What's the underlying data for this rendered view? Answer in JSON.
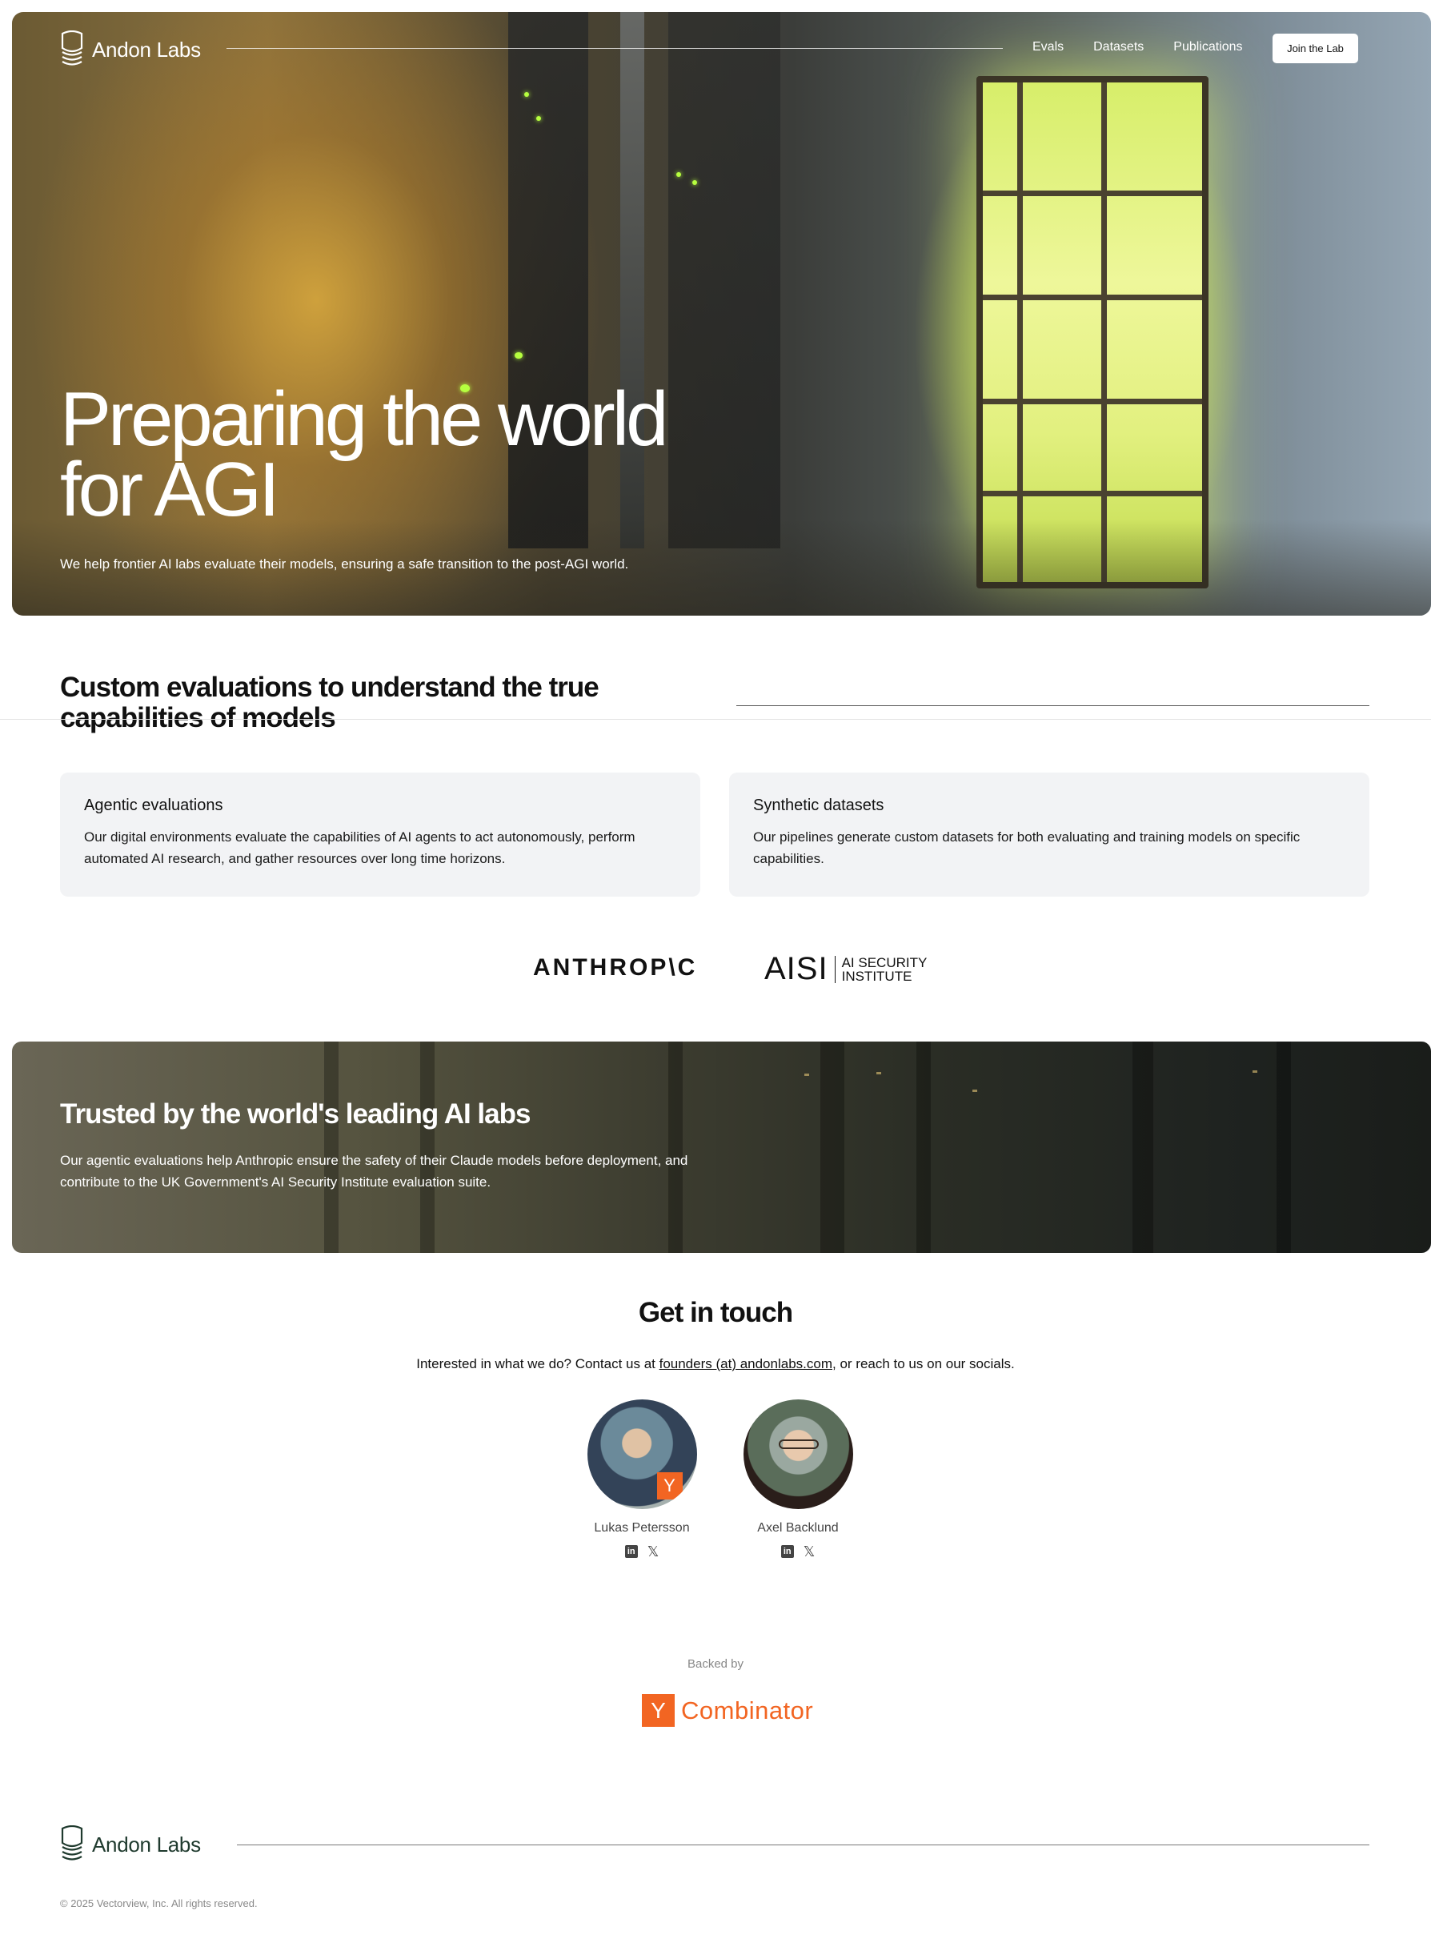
{
  "brand": {
    "name": "Andon Labs"
  },
  "nav": {
    "links": [
      "Evals",
      "Datasets",
      "Publications"
    ],
    "cta": "Join the Lab"
  },
  "hero": {
    "title": "Preparing the world for AGI",
    "subtitle": "We help frontier AI labs evaluate their models, ensuring a safe transition to the post-AGI world."
  },
  "capabilities": {
    "title": "Custom evaluations to understand the true capabilities of models",
    "cards": [
      {
        "title": "Agentic evaluations",
        "desc": "Our digital environments evaluate the capabilities of AI agents to act autonomously, perform automated AI research, and gather resources over long time horizons."
      },
      {
        "title": "Synthetic datasets",
        "desc": "Our pipelines generate custom datasets for both evaluating and training models on specific capabilities."
      }
    ]
  },
  "partners": {
    "anthropic": "ANTHROP\\C",
    "aisi_short": "AISI",
    "aisi_line1": "AI SECURITY",
    "aisi_line2": "INSTITUTE"
  },
  "trusted": {
    "title": "Trusted by the world's leading AI labs",
    "text": "Our agentic evaluations help Anthropic ensure the safety of their Claude models before deployment, and contribute to the UK Government's AI Security Institute evaluation suite."
  },
  "contact": {
    "title": "Get in touch",
    "text_before": "Interested in what we do? Contact us at ",
    "email": "founders (at) andonlabs.com",
    "text_after": ", or reach to us on our socials.",
    "people": [
      {
        "name": "Lukas Petersson",
        "yc_badge": "Y"
      },
      {
        "name": "Axel Backlund"
      }
    ],
    "social_icons": [
      "linkedin-icon",
      "x-icon"
    ]
  },
  "backed": {
    "label": "Backed by",
    "yc_letter": "Y",
    "yc_word": "Combinator"
  },
  "footer": {
    "copyright": "© 2025 Vectorview, Inc. All rights reserved."
  },
  "colors": {
    "accent_orange": "#f26522",
    "card_bg": "#f2f3f5",
    "footer_logo": "#1f3a2e"
  }
}
